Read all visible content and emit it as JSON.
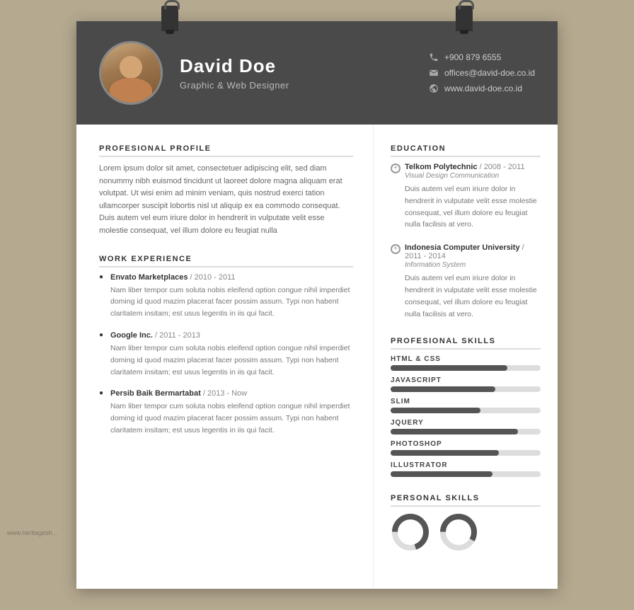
{
  "header": {
    "name": "David Doe",
    "title": "Graphic & Web Designer",
    "phone": "+900 879 6555",
    "email": "offices@david-doe.co.id",
    "website": "www.david-doe.co.id"
  },
  "profile": {
    "section_title": "PROFESIONAL PROFILE",
    "text": "Lorem ipsum dolor sit amet, consectetuer adipiscing elit, sed diam nonummy nibh euismod tincidunt ut laoreet dolore magna aliquam erat volutpat. Ut wisi enim ad minim veniam, quis nostrud exerci tation ullamcorper suscipit lobortis nisl ut aliquip ex ea commodo consequat. Duis autem vel eum iriure dolor in hendrerit in vulputate velit esse molestie consequat, vel illum dolore eu feugiat nulla"
  },
  "work_experience": {
    "section_title": "WORK EXPERIENCE",
    "items": [
      {
        "company": "Envato Marketplaces",
        "year": "2010 - 2011",
        "desc": "Nam liber tempor cum soluta nobis eleifend option congue nihil imperdiet doming id quod mazim placerat facer possim assum. Typi non habent claritatem insitam; est usus legentis in iis qui facit."
      },
      {
        "company": "Google Inc.",
        "year": "2011 - 2013",
        "desc": "Nam liber tempor cum soluta nobis eleifend option congue nihil imperdiet doming id quod mazim placerat facer possim assum. Typi non habent claritatem insitam; est usus legentis in iis qui facit."
      },
      {
        "company": "Persib Baik Bermartabat",
        "year": "2013 - Now",
        "desc": "Nam liber tempor cum soluta nobis eleifend option congue nihil imperdiet doming id quod mazim placerat facer possim assum. Typi non habent claritatem insitam; est usus legentis in iis qui facit."
      }
    ]
  },
  "education": {
    "section_title": "EDUCATION",
    "items": [
      {
        "school": "Telkom Polytechnic",
        "year": "2008 - 2011",
        "field": "Visual Design Communication",
        "desc": "Duis autem vel eum iriure dolor in hendrerit in vulputate velit esse molestie consequat, vel illum dolore eu feugiat nulla facilisis at vero."
      },
      {
        "school": "Indonesia Computer University",
        "year": "2011 - 2014",
        "field": "Information System",
        "desc": "Duis autem vel eum iriure dolor in hendrerit in vulputate velit esse molestie consequat, vel illum dolore eu feugiat nulla facilisis at vero."
      }
    ]
  },
  "skills": {
    "section_title": "PROFESIONAL SKILLS",
    "items": [
      {
        "label": "HTML & CSS",
        "percent": 78
      },
      {
        "label": "JAVASCRIPT",
        "percent": 70
      },
      {
        "label": "SLIM",
        "percent": 60
      },
      {
        "label": "JQUERY",
        "percent": 85
      },
      {
        "label": "PHOTOSHOP",
        "percent": 72
      },
      {
        "label": "ILLUSTRATOR",
        "percent": 68
      }
    ]
  },
  "personal_skills": {
    "section_title": "PERSONAL SKILLS"
  },
  "watermark": "www.heritagesh..."
}
